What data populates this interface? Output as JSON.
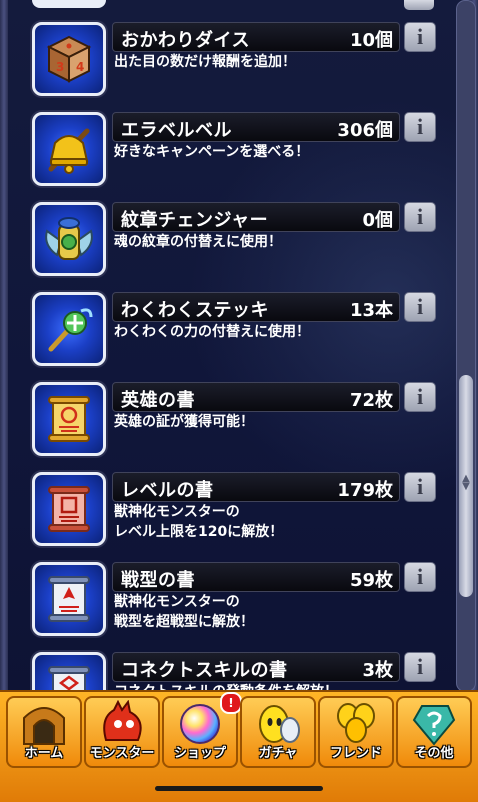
{
  "items": [
    {
      "name": "おかわりダイス",
      "count": "10個",
      "desc": "出た目の数だけ報酬を追加！",
      "icon": "dice-icon"
    },
    {
      "name": "エラベルベル",
      "count": "306個",
      "desc": "好きなキャンペーンを選べる！",
      "icon": "bell-icon"
    },
    {
      "name": "紋章チェンジャー",
      "count": "0個",
      "desc": "魂の紋章の付替えに使用！",
      "icon": "emblem-changer-icon"
    },
    {
      "name": "わくわくステッキ",
      "count": "13本",
      "desc": "わくわくの力の付替えに使用！",
      "icon": "wand-icon"
    },
    {
      "name": "英雄の書",
      "count": "72枚",
      "desc": "英雄の証が獲得可能！",
      "icon": "scroll-icon"
    },
    {
      "name": "レベルの書",
      "count": "179枚",
      "desc": "獣神化モンスターの\nレベル上限を120に解放！",
      "icon": "scroll-icon"
    },
    {
      "name": "戦型の書",
      "count": "59枚",
      "desc": "獣神化モンスターの\n戦型を超戦型に解放！",
      "icon": "scroll-icon"
    },
    {
      "name": "コネクトスキルの書",
      "count": "3枚",
      "desc": "コネクトスキルの発動条件を解放！",
      "icon": "scroll-icon"
    }
  ],
  "info_label": "i",
  "nav": {
    "home": "ホーム",
    "monster": "モンスター",
    "shop": "ショップ",
    "gacha": "ガチャ",
    "friend": "フレンド",
    "other": "その他",
    "shop_badge": "!"
  }
}
